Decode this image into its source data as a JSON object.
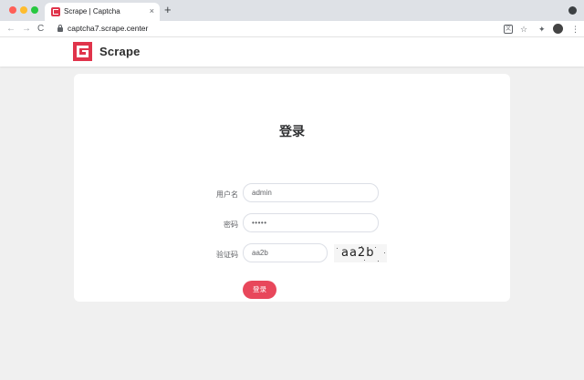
{
  "browser": {
    "tab_title": "Scrape | Captcha",
    "tab_close": "×",
    "new_tab": "+",
    "url": "captcha7.scrape.center",
    "nav": {
      "back": "←",
      "forward": "→",
      "reload": "C"
    },
    "icons": {
      "translate": "文",
      "star": "☆",
      "extensions": "✦",
      "menu": "⋮"
    }
  },
  "site": {
    "brand": "Scrape",
    "logo_color": "#e0344b"
  },
  "login": {
    "title": "登录",
    "username_label": "用户名",
    "username_value": "admin",
    "password_label": "密码",
    "password_value": "•••••",
    "captcha_label": "验证码",
    "captcha_value": "aa2b",
    "captcha_image_text": "aa2b",
    "submit_label": "登录",
    "accent_color": "#e8475b"
  }
}
